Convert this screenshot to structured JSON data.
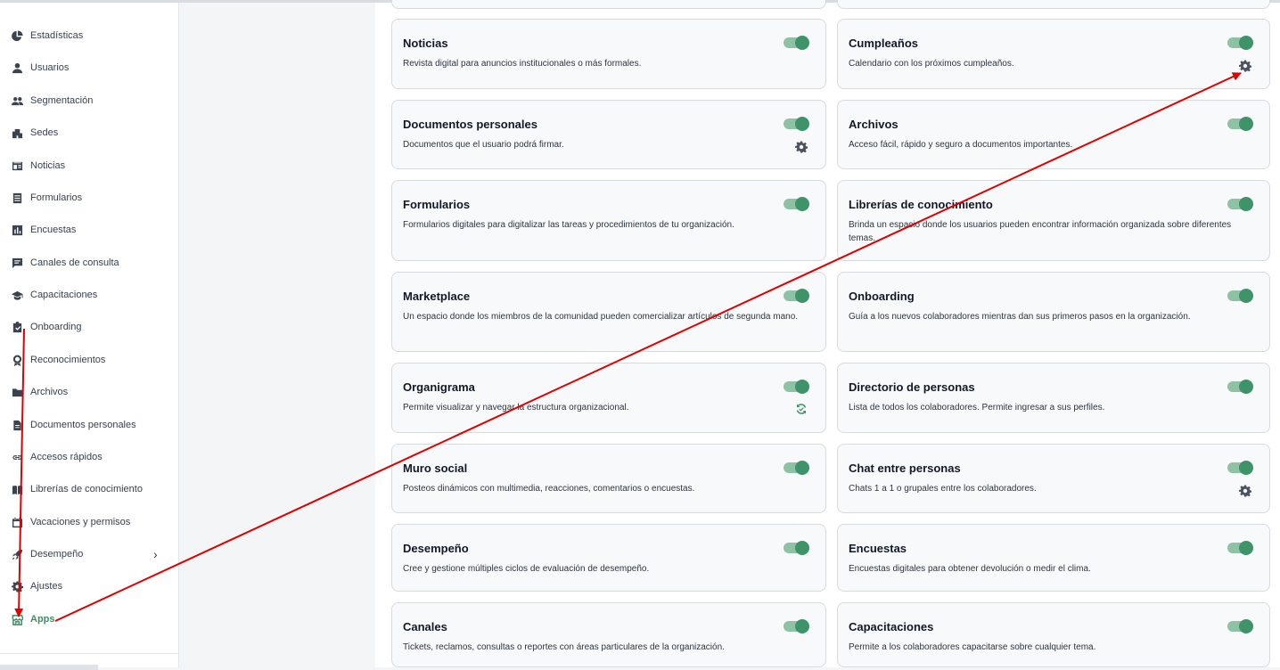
{
  "sidebar": {
    "items": [
      {
        "label": "Estadísticas",
        "icon": "pie-chart-icon"
      },
      {
        "label": "Usuarios",
        "icon": "person-icon"
      },
      {
        "label": "Segmentación",
        "icon": "people-icon"
      },
      {
        "label": "Sedes",
        "icon": "building-icon"
      },
      {
        "label": "Noticias",
        "icon": "newspaper-icon"
      },
      {
        "label": "Formularios",
        "icon": "form-icon"
      },
      {
        "label": "Encuestas",
        "icon": "bar-chart-icon"
      },
      {
        "label": "Canales de consulta",
        "icon": "chat-icon"
      },
      {
        "label": "Capacitaciones",
        "icon": "graduation-cap-icon"
      },
      {
        "label": "Onboarding",
        "icon": "clipboard-check-icon"
      },
      {
        "label": "Reconocimientos",
        "icon": "award-icon"
      },
      {
        "label": "Archivos",
        "icon": "folder-icon"
      },
      {
        "label": "Documentos personales",
        "icon": "document-icon"
      },
      {
        "label": "Accesos rápidos",
        "icon": "link-icon"
      },
      {
        "label": "Librerías de conocimiento",
        "icon": "book-icon"
      },
      {
        "label": "Vacaciones y permisos",
        "icon": "calendar-icon"
      },
      {
        "label": "Desempeño",
        "icon": "rocket-icon"
      },
      {
        "label": "Ajustes",
        "icon": "gear-icon"
      },
      {
        "label": "Apps",
        "icon": "store-icon"
      }
    ],
    "active": "Apps"
  },
  "apps": [
    {
      "title": "Noticias",
      "desc": "Revista digital para anuncios institucionales o más formales.",
      "enabled": true,
      "icon": ""
    },
    {
      "title": "Cumpleaños",
      "desc": "Calendario con los próximos cumpleaños.",
      "enabled": true,
      "icon": "gear-icon"
    },
    {
      "title": "Documentos personales",
      "desc": "Documentos que el usuario podrá firmar.",
      "enabled": true,
      "icon": "gear-icon"
    },
    {
      "title": "Archivos",
      "desc": "Acceso fácil, rápido y seguro a documentos importantes.",
      "enabled": true,
      "icon": ""
    },
    {
      "title": "Formularios",
      "desc": "Formularios digitales para digitalizar las tareas y procedimientos de tu organización.",
      "enabled": true,
      "icon": ""
    },
    {
      "title": "Librerías de conocimiento",
      "desc": "Brinda un espacio donde los usuarios pueden encontrar información organizada sobre diferentes temas.",
      "enabled": true,
      "icon": ""
    },
    {
      "title": "Marketplace",
      "desc": "Un espacio donde los miembros de la comunidad pueden comercializar artículos de segunda mano.",
      "enabled": true,
      "icon": ""
    },
    {
      "title": "Onboarding",
      "desc": "Guía a los nuevos colaboradores mientras dan sus primeros pasos en la organización.",
      "enabled": true,
      "icon": ""
    },
    {
      "title": "Organigrama",
      "desc": "Permite visualizar y navegar la estructura organizacional.",
      "enabled": true,
      "icon": "sync-icon"
    },
    {
      "title": "Directorio de personas",
      "desc": "Lista de todos los colaboradores. Permite ingresar a sus perfiles.",
      "enabled": true,
      "icon": ""
    },
    {
      "title": "Muro social",
      "desc": "Posteos dinámicos con multimedia, reacciones, comentarios o encuestas.",
      "enabled": true,
      "icon": ""
    },
    {
      "title": "Chat entre personas",
      "desc": "Chats 1 a 1 o grupales entre los colaboradores.",
      "enabled": true,
      "icon": "gear-icon"
    },
    {
      "title": "Desempeño",
      "desc": "Cree y gestione múltiples ciclos de evaluación de desempeño.",
      "enabled": true,
      "icon": ""
    },
    {
      "title": "Encuestas",
      "desc": "Encuestas digitales para obtener devolución o medir el clima.",
      "enabled": true,
      "icon": ""
    },
    {
      "title": "Canales",
      "desc": "Tickets, reclamos, consultas o reportes con áreas particulares de la organización.",
      "enabled": true,
      "icon": ""
    },
    {
      "title": "Capacitaciones",
      "desc": "Permite a los colaboradores capacitarse sobre cualquier tema.",
      "enabled": true,
      "icon": ""
    }
  ],
  "colors": {
    "accent": "#3f9368",
    "toggle_track": "#8ec2a4",
    "annotation": "#e00000"
  }
}
